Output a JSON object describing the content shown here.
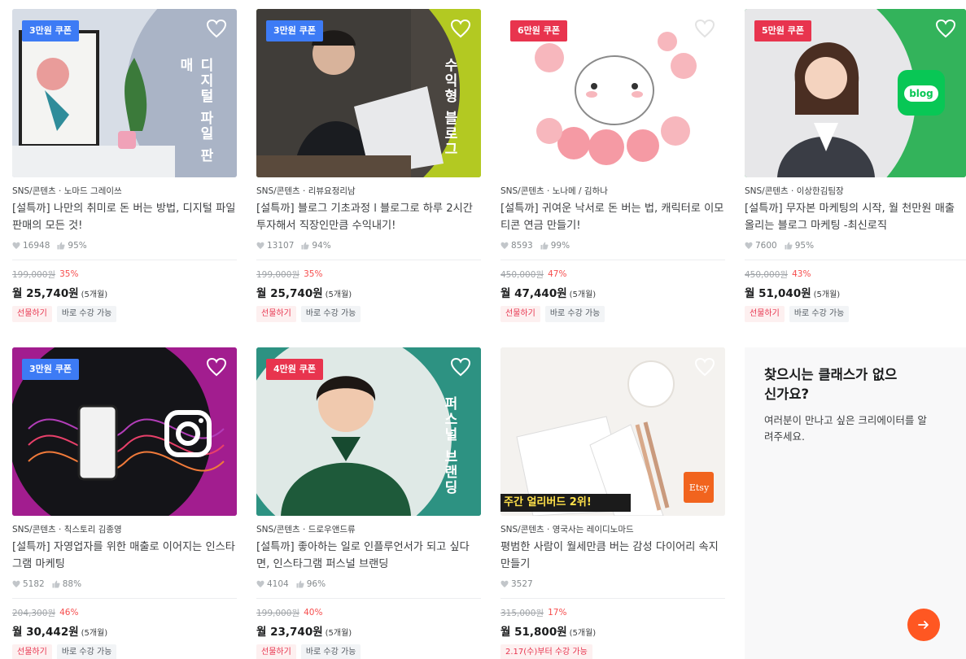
{
  "colors": {
    "coupon_blue": "#3d7bf5",
    "coupon_red": "#e8344e",
    "discount": "#f64d4d",
    "promo_arrow": "#ff5722"
  },
  "cards": [
    {
      "coupon": "3만원 쿠폰",
      "coupon_color": "blue",
      "thumb_text": "디지털 파일 판매",
      "meta": "SNS/콘텐츠 · 노마드 그레이쓰",
      "title": "[설특까] 나만의 취미로 돈 버는 방법, 디지털 파일 판매의 모든 것!",
      "likes": "16948",
      "rating": "95%",
      "original_price": "199,000원",
      "discount": "35%",
      "monthly": "월 25,740원",
      "installment": "(5개월)",
      "tags": [
        "선물하기",
        "바로 수강 가능"
      ]
    },
    {
      "coupon": "3만원 쿠폰",
      "coupon_color": "blue",
      "thumb_text": "수익형 블로그",
      "meta": "SNS/콘텐츠 · 리뷰요정리남",
      "title": "[설특까] 블로그 기초과정 l 블로그로 하루 2시간 투자해서 직장인만큼 수익내기!",
      "likes": "13107",
      "rating": "94%",
      "original_price": "199,000원",
      "discount": "35%",
      "monthly": "월 25,740원",
      "installment": "(5개월)",
      "tags": [
        "선물하기",
        "바로 수강 가능"
      ]
    },
    {
      "coupon": "6만원 쿠폰",
      "coupon_color": "red",
      "thumb_text": "",
      "meta": "SNS/콘텐츠 · 노나메 / 김하나",
      "title": "[설특까] 귀여운 낙서로 돈 버는 법, 캐릭터로 이모티콘 연금 만들기!",
      "likes": "8593",
      "rating": "99%",
      "original_price": "450,000원",
      "discount": "47%",
      "monthly": "월 47,440원",
      "installment": "(5개월)",
      "tags": [
        "선물하기",
        "바로 수강 가능"
      ]
    },
    {
      "coupon": "5만원 쿠폰",
      "coupon_color": "red",
      "thumb_text": "blog",
      "meta": "SNS/콘텐츠 · 이상한김팀장",
      "title": "[설특까] 무자본 마케팅의 시작, 월 천만원 매출 올리는 블로그 마케팅 -최신로직",
      "likes": "7600",
      "rating": "95%",
      "original_price": "450,000원",
      "discount": "43%",
      "monthly": "월 51,040원",
      "installment": "(5개월)",
      "tags": [
        "선물하기",
        "바로 수강 가능"
      ]
    },
    {
      "coupon": "3만원 쿠폰",
      "coupon_color": "blue",
      "thumb_text": "",
      "meta": "SNS/콘텐츠 · 칙스토리 김종영",
      "title": "[설특까] 자영업자를 위한 매출로 이어지는 인스타그램 마케팅",
      "likes": "5182",
      "rating": "88%",
      "original_price": "204,300원",
      "discount": "46%",
      "monthly": "월 30,442원",
      "installment": "(5개월)",
      "tags": [
        "선물하기",
        "바로 수강 가능"
      ]
    },
    {
      "coupon": "4만원 쿠폰",
      "coupon_color": "red",
      "thumb_text": "퍼스널 브랜딩",
      "meta": "SNS/콘텐츠 · 드로우앤드류",
      "title": "[설특까] 좋아하는 일로 인플루언서가 되고 싶다면, 인스타그램 퍼스널 브랜딩",
      "likes": "4104",
      "rating": "96%",
      "original_price": "199,000원",
      "discount": "40%",
      "monthly": "월 23,740원",
      "installment": "(5개월)",
      "tags": [
        "선물하기",
        "바로 수강 가능"
      ]
    },
    {
      "coupon": "",
      "coupon_color": "",
      "thumb_text": "주간 얼리버드 2위!",
      "thumb_badge": "Etsy",
      "meta": "SNS/콘텐츠 · 영국사는 레이디노마드",
      "title": "평범한 사람이 월세만큼 버는 감성 다이어리 속지 만들기",
      "likes": "3527",
      "rating": "",
      "original_price": "315,000원",
      "discount": "17%",
      "monthly": "월 51,800원",
      "installment": "(5개월)",
      "tags": [
        "2.17(수)부터 수강 가능"
      ]
    }
  ],
  "promo": {
    "heading": "찾으시는 클래스가 없으신가요?",
    "body": "여러분이 만나고 싶은 크리에이터를 알려주세요.",
    "arrow_icon": "arrow-right-icon"
  }
}
